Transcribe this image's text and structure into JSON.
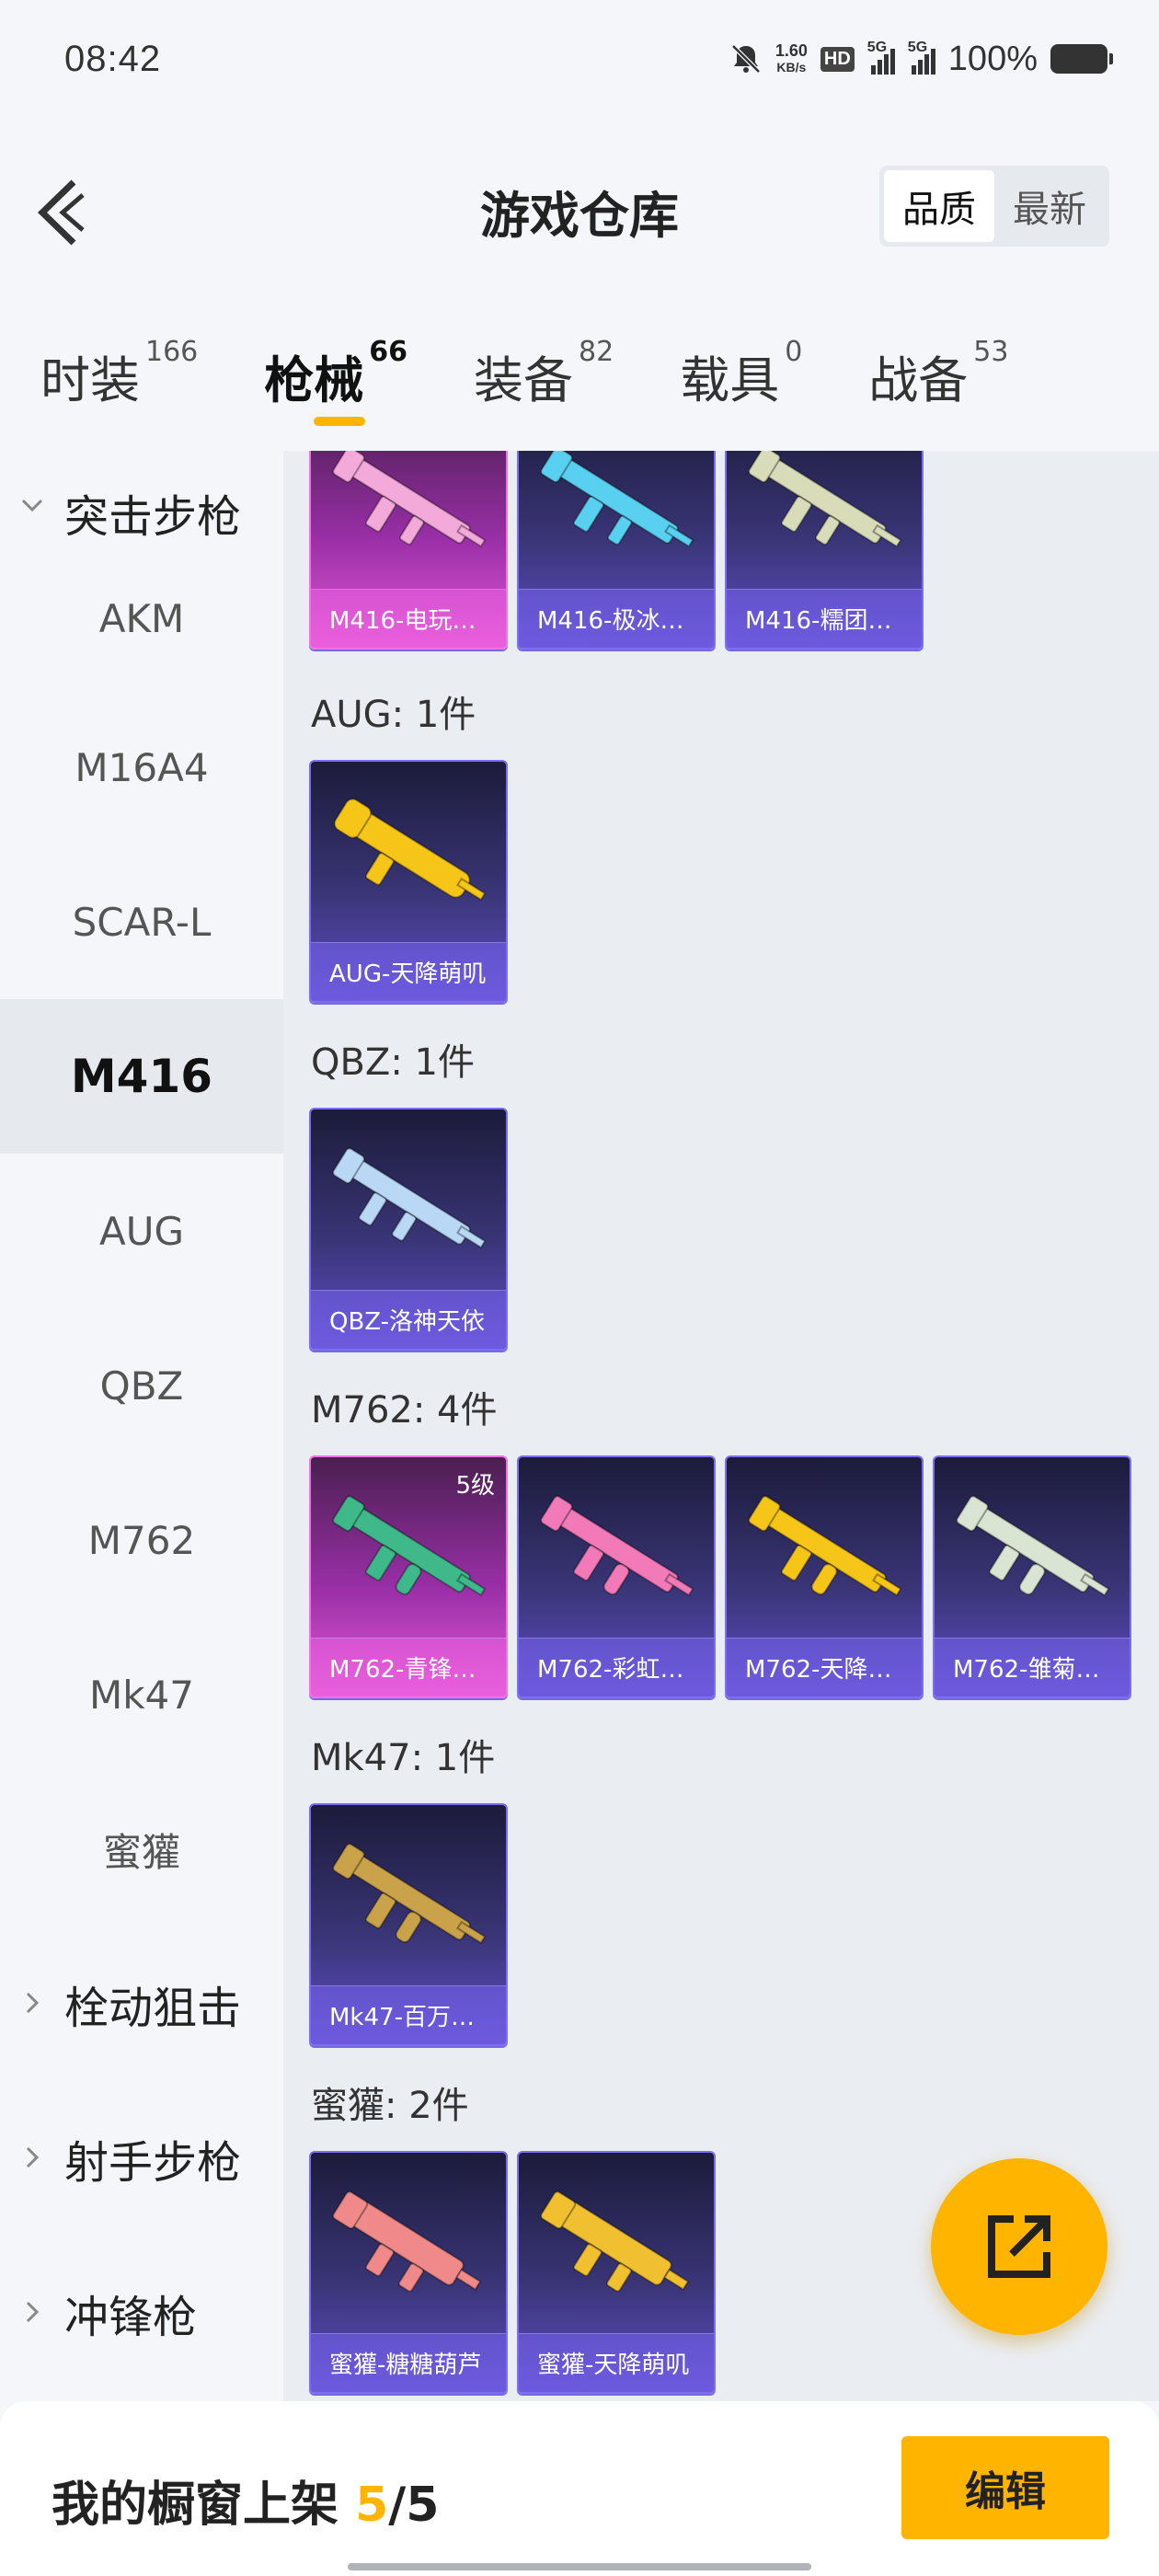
{
  "status_bar": {
    "time": "08:42",
    "net_speed_value": "1.60",
    "net_speed_unit": "KB/s",
    "hd_label": "HD",
    "signal1_label": "5G",
    "signal2_label": "5G",
    "battery": "100%",
    "icons": [
      "bell-muted-icon",
      "hd-icon",
      "signal-icon",
      "battery-icon"
    ]
  },
  "header": {
    "title": "游戏仓库",
    "sort_options": [
      {
        "label": "品质",
        "active": true
      },
      {
        "label": "最新",
        "active": false
      }
    ]
  },
  "tabs": [
    {
      "label": "时装",
      "count": "166",
      "active": false
    },
    {
      "label": "枪械",
      "count": "66",
      "active": true
    },
    {
      "label": "装备",
      "count": "82",
      "active": false
    },
    {
      "label": "载具",
      "count": "0",
      "active": false
    },
    {
      "label": "战备",
      "count": "53",
      "active": false
    }
  ],
  "sidebar": {
    "items": [
      {
        "label": "突击步枪",
        "type": "group",
        "expanded": true
      },
      {
        "label": "AKM",
        "type": "item"
      },
      {
        "label": "M16A4",
        "type": "item"
      },
      {
        "label": "SCAR-L",
        "type": "item"
      },
      {
        "label": "M416",
        "type": "item",
        "active": true
      },
      {
        "label": "AUG",
        "type": "item"
      },
      {
        "label": "QBZ",
        "type": "item"
      },
      {
        "label": "M762",
        "type": "item"
      },
      {
        "label": "Mk47",
        "type": "item"
      },
      {
        "label": "蜜獾",
        "type": "item"
      },
      {
        "label": "栓动狙击",
        "type": "group",
        "expanded": false
      },
      {
        "label": "射手步枪",
        "type": "group",
        "expanded": false
      },
      {
        "label": "冲锋枪",
        "type": "group",
        "expanded": false
      }
    ]
  },
  "sections": [
    {
      "label": "",
      "cards": [
        {
          "name": "M416-电玩…",
          "style": "pink",
          "gun_color": "#f3a9d9"
        },
        {
          "name": "M416-极冰…",
          "style": "blue",
          "gun_color": "#5ad0f0"
        },
        {
          "name": "M416-糯团…",
          "style": "blue",
          "gun_color": "#d8dcb8"
        }
      ]
    },
    {
      "label": "AUG: 1件",
      "cards": [
        {
          "name": "AUG-天降萌叽",
          "style": "blue",
          "gun_color": "#f5c518"
        }
      ]
    },
    {
      "label": "QBZ: 1件",
      "cards": [
        {
          "name": "QBZ-洛神天依",
          "style": "blue",
          "gun_color": "#b9d8f5"
        }
      ]
    },
    {
      "label": "M762: 4件",
      "cards": [
        {
          "name": "M762-青锋…",
          "style": "pink",
          "gun_color": "#3fb98a",
          "level": "5级"
        },
        {
          "name": "M762-彩虹…",
          "style": "blue",
          "gun_color": "#f27ab8"
        },
        {
          "name": "M762-天降…",
          "style": "blue",
          "gun_color": "#f5c518"
        },
        {
          "name": "M762-雏菊…",
          "style": "blue",
          "gun_color": "#d9e4d2"
        }
      ]
    },
    {
      "label": "Mk47: 1件",
      "cards": [
        {
          "name": "Mk47-百万…",
          "style": "blue",
          "gun_color": "#c9a24a"
        }
      ]
    },
    {
      "label": "蜜獾: 2件",
      "cards": [
        {
          "name": "蜜獾-糖糖葫芦",
          "style": "blue",
          "gun_color": "#f08a8a"
        },
        {
          "name": "蜜獾-天降萌叽",
          "style": "blue",
          "gun_color": "#f0c030"
        }
      ]
    }
  ],
  "bottom_bar": {
    "showcase_prefix": "我的橱窗上架 ",
    "showcase_count": "5",
    "showcase_total": "/5",
    "edit_label": "编辑"
  },
  "share_button_icon": "share-external-icon"
}
